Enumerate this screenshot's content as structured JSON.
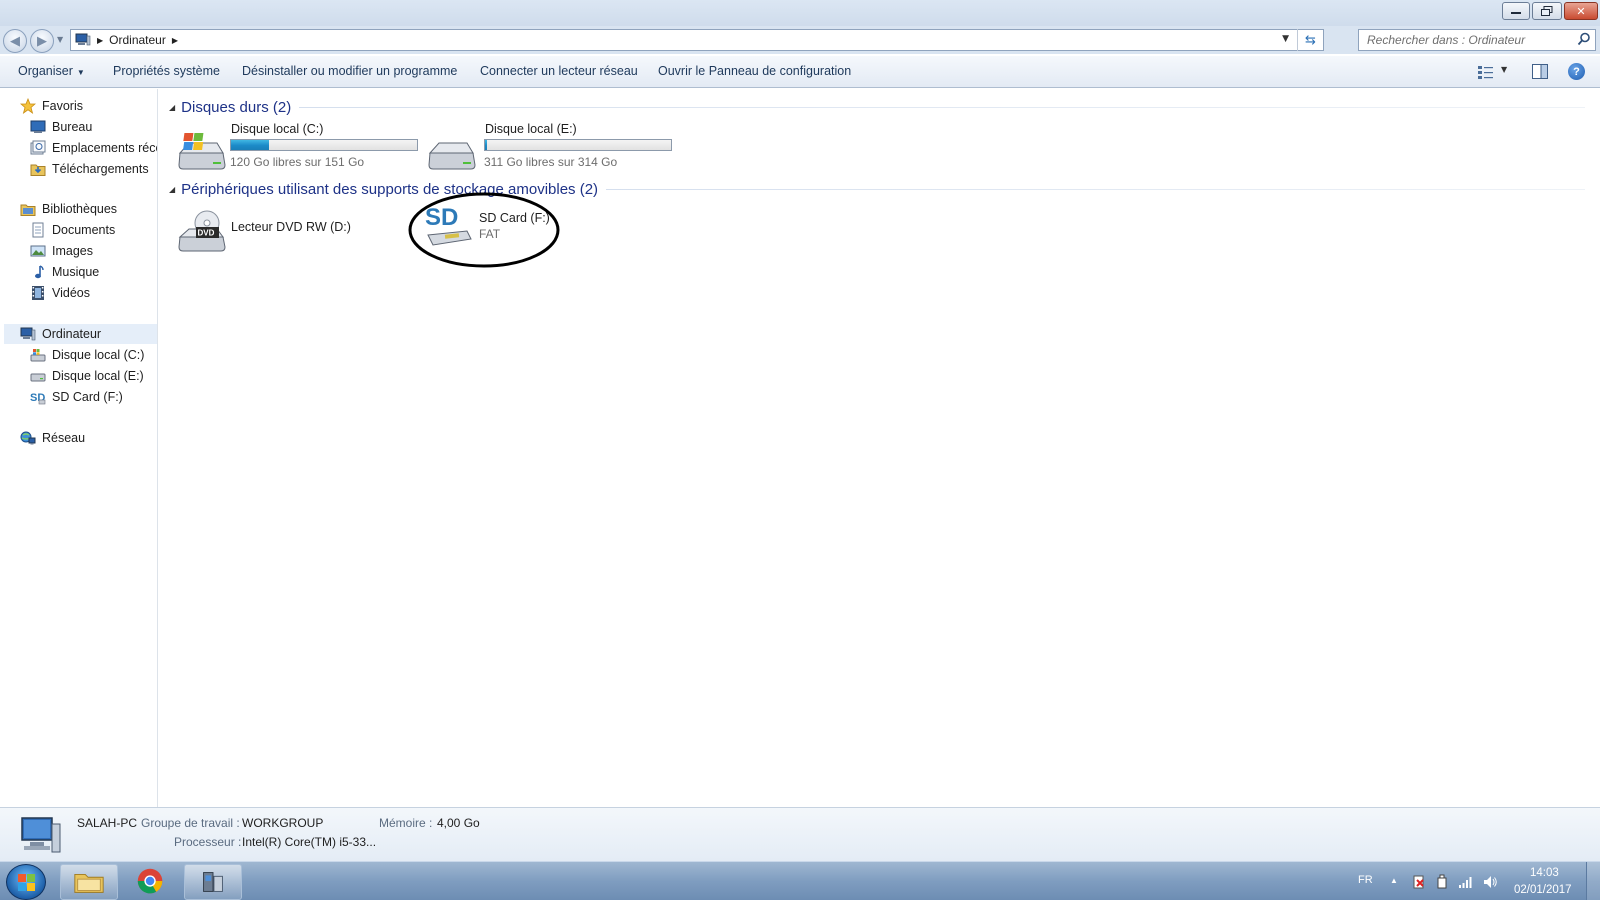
{
  "window": {
    "minimize_icon": "minimize-icon",
    "maximize_icon": "restore-icon",
    "close_icon": "close-icon",
    "close_glyph": "✕"
  },
  "address": {
    "breadcrumb": "Ordinateur",
    "search_placeholder": "Rechercher dans : Ordinateur"
  },
  "toolbar": {
    "organiser": "Organiser",
    "system_properties": "Propriétés système",
    "uninstall": "Désinstaller ou modifier un programme",
    "connect_drive": "Connecter un lecteur réseau",
    "control_panel": "Ouvrir le Panneau de configuration",
    "help_glyph": "?"
  },
  "sidebar": {
    "favorites": "Favoris",
    "bureau": "Bureau",
    "recent": "Emplacements récents",
    "downloads": "Téléchargements",
    "libraries": "Bibliothèques",
    "documents": "Documents",
    "images": "Images",
    "music": "Musique",
    "videos": "Vidéos",
    "computer": "Ordinateur",
    "drive_c": "Disque local (C:)",
    "drive_e": "Disque local (E:)",
    "sd_card": "SD Card (F:)",
    "network": "Réseau"
  },
  "groups": {
    "hard_drives": "Disques durs (2)",
    "removable": "Périphériques utilisant des supports de stockage amovibles (2)"
  },
  "drives": {
    "c": {
      "name": "Disque local (C:)",
      "free_text": "120 Go libres sur 151 Go",
      "used_fraction": 0.205
    },
    "e": {
      "name": "Disque local (E:)",
      "free_text": "311 Go libres sur 314 Go",
      "used_fraction": 0.01
    },
    "d": {
      "name": "Lecteur DVD RW (D:)",
      "icon_label": "DVD"
    },
    "f": {
      "name": "SD Card (F:)",
      "filesystem": "FAT",
      "icon_label": "SD"
    }
  },
  "details": {
    "computer_name": "SALAH-PC",
    "workgroup_label": "Groupe de travail :",
    "workgroup_value": "WORKGROUP",
    "memory_label": "Mémoire :",
    "memory_value": "4,00 Go",
    "processor_label": "Processeur :",
    "processor_value": "Intel(R) Core(TM) i5-33..."
  },
  "taskbar": {
    "language": "FR",
    "time": "14:03",
    "date": "02/01/2017"
  },
  "colors": {
    "group_title": "#1e3287",
    "capacity_fill": "#1b8ac8",
    "annotation": "#000000"
  }
}
